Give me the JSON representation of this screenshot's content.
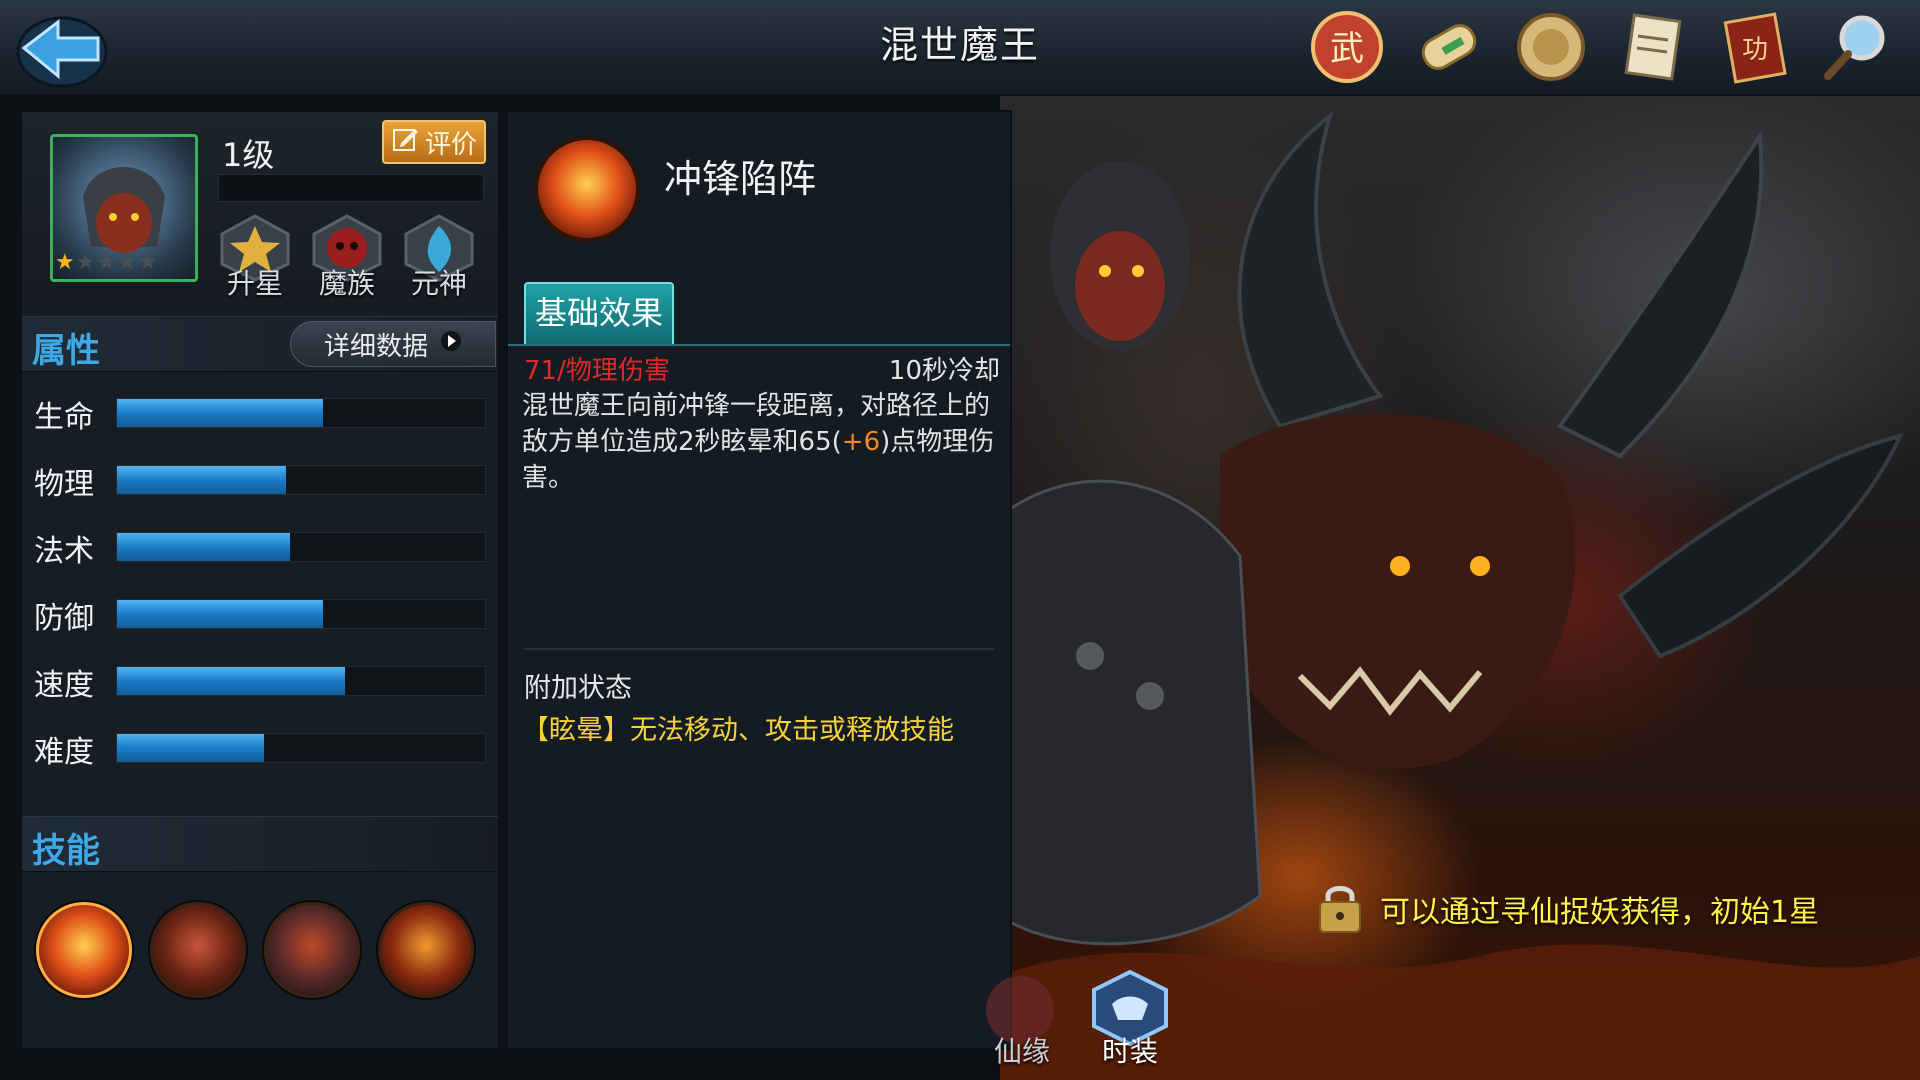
{
  "header": {
    "title": "混世魔王",
    "back_icon": "back-arrow-icon",
    "icons": [
      {
        "name": "battle-seal-icon",
        "glyph": "武"
      },
      {
        "name": "scroll-icon",
        "glyph": ""
      },
      {
        "name": "coin-badge-icon",
        "glyph": ""
      },
      {
        "name": "document-icon",
        "glyph": ""
      },
      {
        "name": "book-icon",
        "glyph": "功"
      },
      {
        "name": "magnifier-icon",
        "glyph": ""
      }
    ]
  },
  "hero": {
    "level": "1级",
    "rate_label": "评价",
    "stars": {
      "filled": 1,
      "total": 5
    },
    "badges": [
      {
        "label": "升星",
        "icon": "star-badge-icon"
      },
      {
        "label": "魔族",
        "icon": "demon-race-icon"
      },
      {
        "label": "元神",
        "icon": "spirit-flame-icon"
      }
    ]
  },
  "attributes": {
    "title": "属性",
    "detail_label": "详细数据",
    "stats": [
      {
        "label": "生命",
        "value": 0.56
      },
      {
        "label": "物理",
        "value": 0.46
      },
      {
        "label": "法术",
        "value": 0.47
      },
      {
        "label": "防御",
        "value": 0.56
      },
      {
        "label": "速度",
        "value": 0.62
      },
      {
        "label": "难度",
        "value": 0.4
      }
    ]
  },
  "skills": {
    "title": "技能",
    "icons": [
      "skill-charge-icon",
      "skill-demon-face-icon",
      "skill-horned-mask-icon",
      "skill-fire-beast-icon"
    ]
  },
  "skill_detail": {
    "name": "冲锋陷阵",
    "tab": "基础效果",
    "damage": "71/物理伤害",
    "cooldown": "10秒冷却",
    "desc_before": "混世魔王向前冲锋一段距离，对路径上的敌方单位造成2秒眩晕和65(",
    "desc_highlight": "+6",
    "desc_after": ")点物理伤害。",
    "extra_title": "附加状态",
    "extra_text": "【眩晕】无法移动、攻击或释放技能"
  },
  "unlock": {
    "text": "可以通过寻仙捉妖获得，初始1星"
  },
  "bottom_tabs": [
    {
      "label": "仙缘"
    },
    {
      "label": "时装"
    }
  ],
  "colors": {
    "accent_blue": "#3fa8e6",
    "stat_fill": "#1b7cc7",
    "damage_red": "#e02a2a",
    "status_yellow": "#f5d23a",
    "unlock_yellow": "#fff24a",
    "tab_teal": "#1fa3a6",
    "rate_orange": "#e9a33b"
  }
}
